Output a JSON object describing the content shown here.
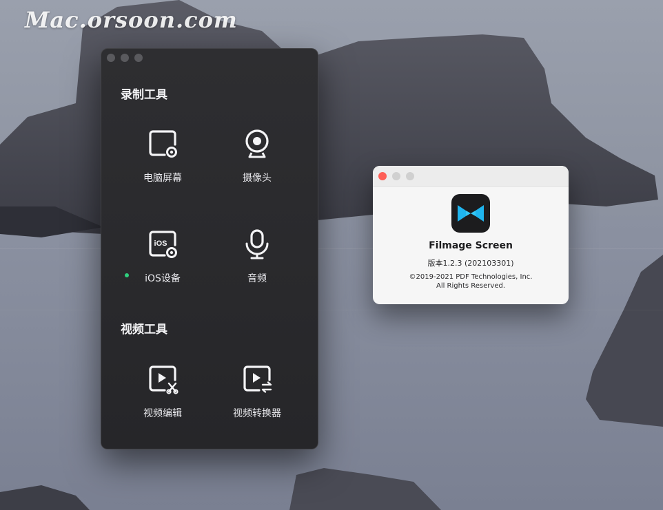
{
  "watermark": "Mac.orsoon.com",
  "main_window": {
    "section_record": "录制工具",
    "section_video": "视频工具",
    "tools": {
      "screen": "电脑屏幕",
      "camera": "摄像头",
      "ios": "iOS设备",
      "audio": "音频",
      "edit": "视频编辑",
      "convert": "视频转换器"
    },
    "ios_status_color": "#2fd07d"
  },
  "about_window": {
    "app_name": "Filmage Screen",
    "version": "版本1.2.3 (202103301)",
    "copyright": "©2019-2021 PDF Technologies, Inc.",
    "rights": "All Rights Reserved.",
    "icon_colors": {
      "bg": "#1c1c1e",
      "accent": "#1fb5ef"
    }
  },
  "traffic_colors": {
    "close": "#fe5f57",
    "minimize": "#d0d0d0",
    "zoom": "#d0d0d0",
    "inactive": "#5a5a5e"
  }
}
